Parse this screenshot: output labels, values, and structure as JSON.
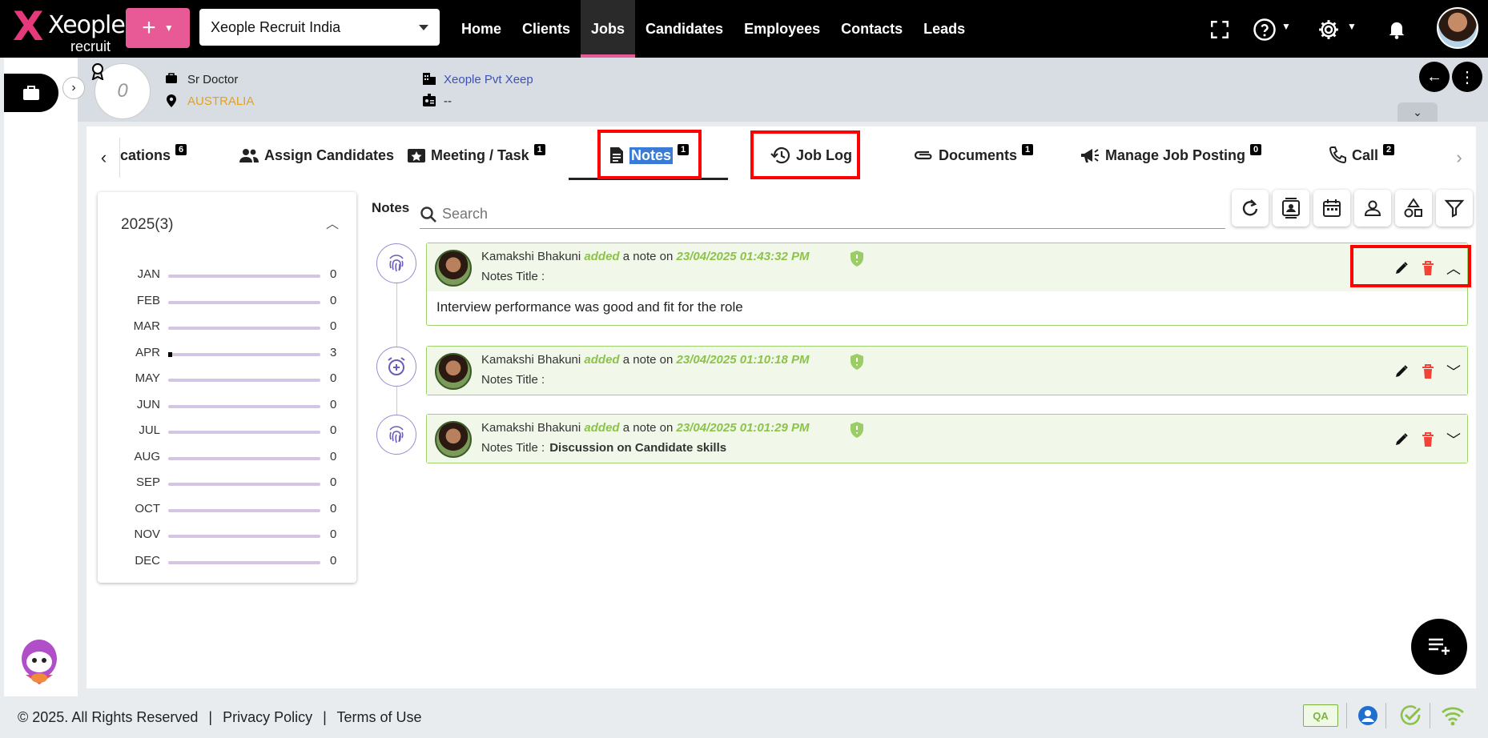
{
  "app": {
    "logo_text": "Xeople",
    "logo_sub": "recruit",
    "company": "Xeople Recruit India",
    "nav": [
      "Home",
      "Clients",
      "Jobs",
      "Candidates",
      "Employees",
      "Contacts",
      "Leads"
    ],
    "active_nav": "Jobs"
  },
  "job_header": {
    "avatar_letter": "0",
    "title": "Sr Doctor",
    "location": "AUSTRALIA",
    "client": "Xeople Pvt Xeep",
    "contact": "--"
  },
  "tabs": [
    {
      "label": "cations",
      "badge": "6"
    },
    {
      "label": "Assign Candidates",
      "badge": ""
    },
    {
      "label": "Meeting / Task",
      "badge": "1"
    },
    {
      "label": "Notes",
      "badge": "1"
    },
    {
      "label": "Job Log",
      "badge": ""
    },
    {
      "label": "Documents",
      "badge": "1"
    },
    {
      "label": "Manage Job Posting",
      "badge": "0"
    },
    {
      "label": "Call",
      "badge": "2"
    }
  ],
  "year_panel": {
    "title": "2025(3)",
    "months": [
      {
        "m": "JAN",
        "count": "0"
      },
      {
        "m": "FEB",
        "count": "0"
      },
      {
        "m": "MAR",
        "count": "0"
      },
      {
        "m": "APR",
        "count": "3"
      },
      {
        "m": "MAY",
        "count": "0"
      },
      {
        "m": "JUN",
        "count": "0"
      },
      {
        "m": "JUL",
        "count": "0"
      },
      {
        "m": "AUG",
        "count": "0"
      },
      {
        "m": "SEP",
        "count": "0"
      },
      {
        "m": "OCT",
        "count": "0"
      },
      {
        "m": "NOV",
        "count": "0"
      },
      {
        "m": "DEC",
        "count": "0"
      }
    ],
    "max_count": 3
  },
  "notes_section": {
    "label": "Notes",
    "search_placeholder": "Search"
  },
  "notes": [
    {
      "author": "Kamakshi Bhakuni",
      "action": "added",
      "mid": "a note on",
      "date": "23/04/2025 01:43:32 PM",
      "title_label": "Notes Title :",
      "title": "",
      "body": "Interview performance was good and fit for the role",
      "expanded": true
    },
    {
      "author": "Kamakshi Bhakuni",
      "action": "added",
      "mid": "a note on",
      "date": "23/04/2025 01:10:18 PM",
      "title_label": "Notes Title :",
      "title": "",
      "body": "",
      "expanded": false
    },
    {
      "author": "Kamakshi Bhakuni",
      "action": "added",
      "mid": "a note on",
      "date": "23/04/2025 01:01:29 PM",
      "title_label": "Notes Title :",
      "title": "Discussion on Candidate skills",
      "body": "",
      "expanded": false
    }
  ],
  "footer": {
    "copyright": "© 2025. All Rights Reserved",
    "privacy": "Privacy Policy",
    "terms": "Terms of Use",
    "env_badge": "QA"
  },
  "colors": {
    "accent": "#e85a96",
    "note_green": "#8bc34a",
    "highlight": "#ff0000"
  }
}
